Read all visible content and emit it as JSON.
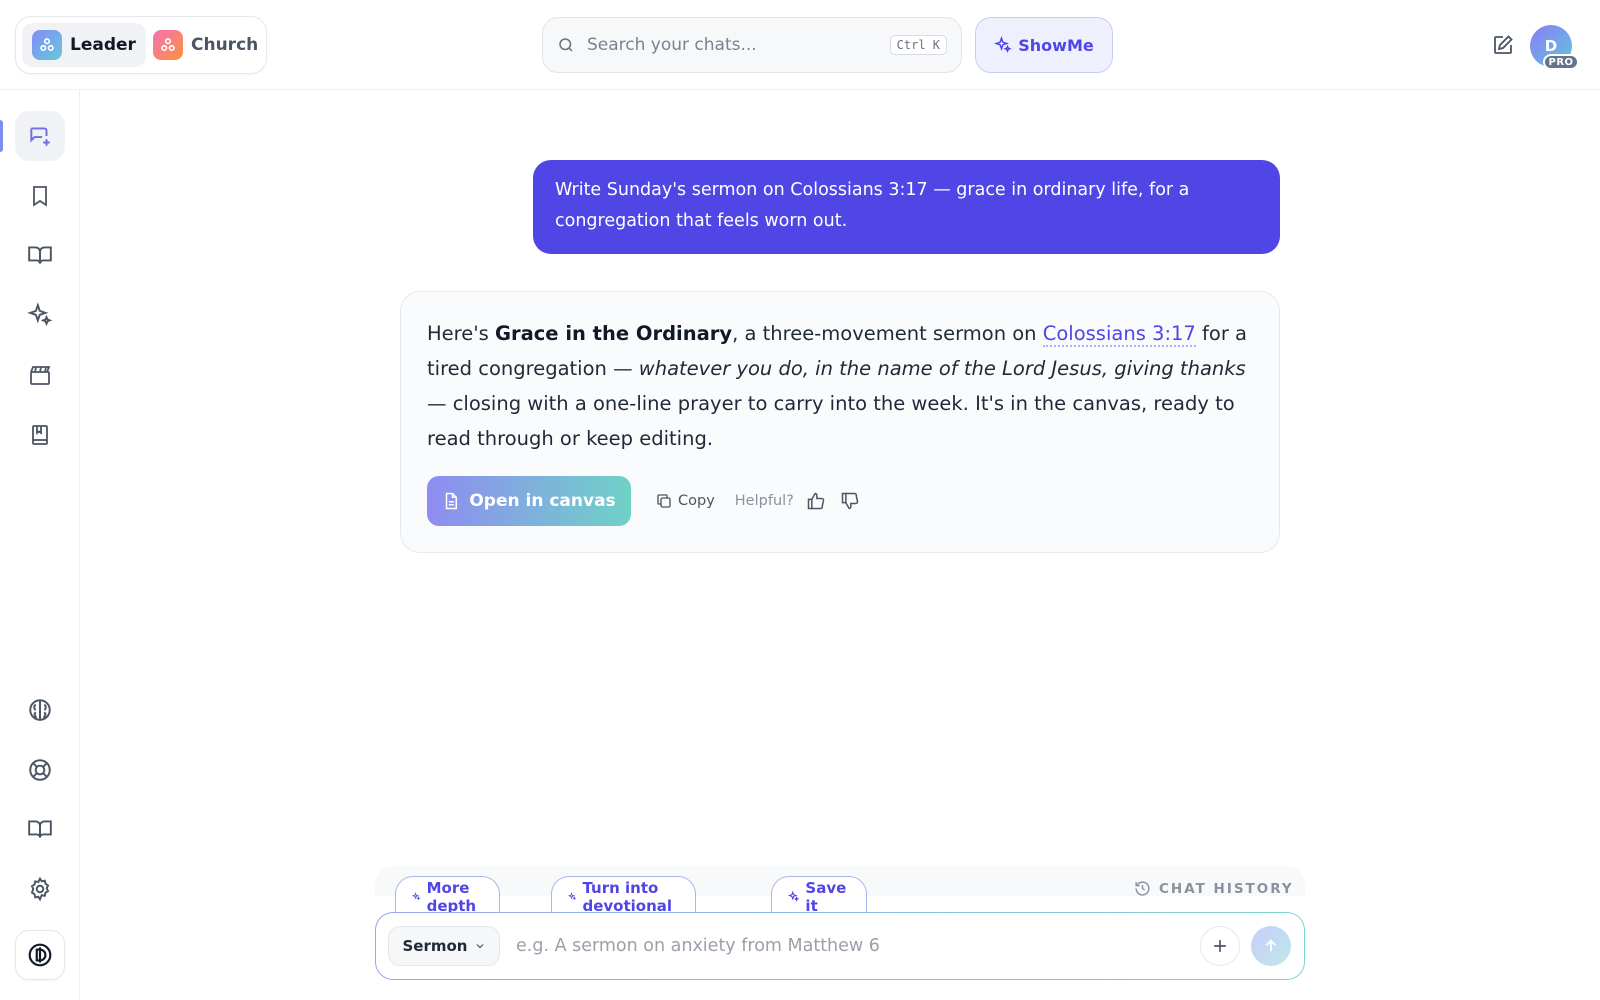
{
  "header": {
    "workspaces": [
      {
        "label": "Leader",
        "active": true
      },
      {
        "label": "Church",
        "active": false
      }
    ],
    "search": {
      "placeholder": "Search your chats...",
      "shortcut": "Ctrl K"
    },
    "showme_label": "ShowMe",
    "avatar": {
      "initial": "D",
      "badge": "PRO"
    }
  },
  "sidebar": {
    "items": [
      {
        "icon": "new-chat-icon",
        "active": true
      },
      {
        "icon": "bookmark-icon"
      },
      {
        "icon": "book-open-icon"
      },
      {
        "icon": "sparkles-icon"
      },
      {
        "icon": "clapperboard-icon"
      },
      {
        "icon": "notebook-icon"
      }
    ],
    "bottom_items": [
      {
        "icon": "brain-icon"
      },
      {
        "icon": "lifebuoy-icon"
      },
      {
        "icon": "book-open-icon"
      },
      {
        "icon": "gear-icon"
      },
      {
        "icon": "brand-logo-icon"
      }
    ]
  },
  "chat": {
    "user_message": "Write Sunday's sermon on Colossians 3:17 — grace in ordinary life, for a congregation that feels worn out.",
    "assistant": {
      "t1": "Here's ",
      "title": "Grace in the Ordinary",
      "t2": ", a three-movement sermon on ",
      "reference": "Colossians 3:17",
      "t3": " for a tired congregation — ",
      "quote": "whatever you do, in the name of the Lord Jesus, giving thanks",
      "t4": " — closing with a one-line prayer to carry into the week. It's in the canvas, ready to read through or keep editing.",
      "open_canvas_label": "Open in canvas",
      "copy_label": "Copy",
      "helpful_label": "Helpful?"
    }
  },
  "composer": {
    "chips": [
      "More depth",
      "Turn into devotional",
      "Save it"
    ],
    "history_label": "CHAT HISTORY",
    "mode": "Sermon",
    "placeholder": "e.g. A sermon on anxiety from Matthew 6"
  },
  "colors": {
    "accent": "#4f46e5",
    "user_bubble": "#4f46e5",
    "gradient_start": "#8f8cf2",
    "gradient_end": "#6fd2c7"
  }
}
